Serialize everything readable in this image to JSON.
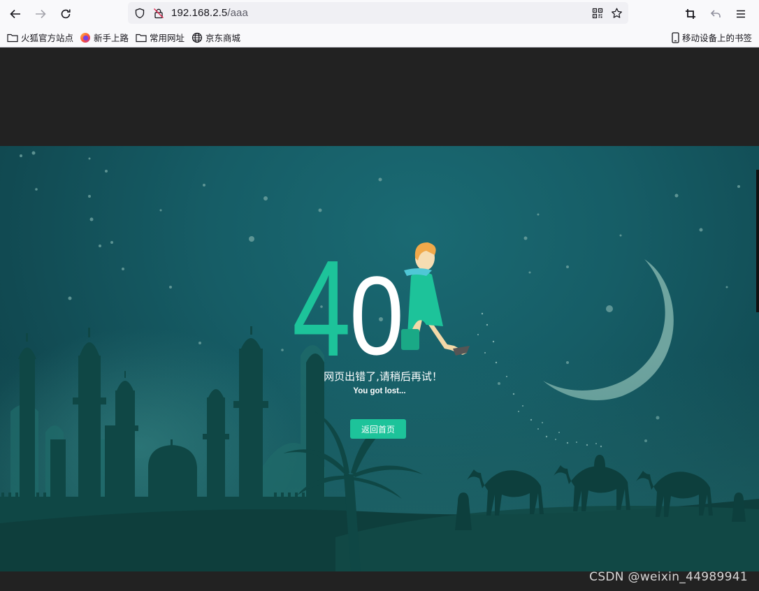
{
  "browser": {
    "url_host": "192.168.2.5",
    "url_path": "/aaa",
    "bookmarks": [
      {
        "label": "火狐官方站点",
        "icon": "folder-icon"
      },
      {
        "label": "新手上路",
        "icon": "firefox-icon"
      },
      {
        "label": "常用网址",
        "icon": "folder-icon"
      },
      {
        "label": "京东商城",
        "icon": "globe-icon"
      }
    ],
    "mobile_bookmarks": "移动设备上的书签"
  },
  "error_page": {
    "code_digits": [
      "4",
      "0"
    ],
    "message_cn": "网页出错了,请稍后再试！",
    "message_en": "You got lost...",
    "home_button": "返回首页",
    "colors": {
      "accent": "#1dc39a",
      "background": "#165d66"
    }
  },
  "watermark": "CSDN @weixin_44989941"
}
